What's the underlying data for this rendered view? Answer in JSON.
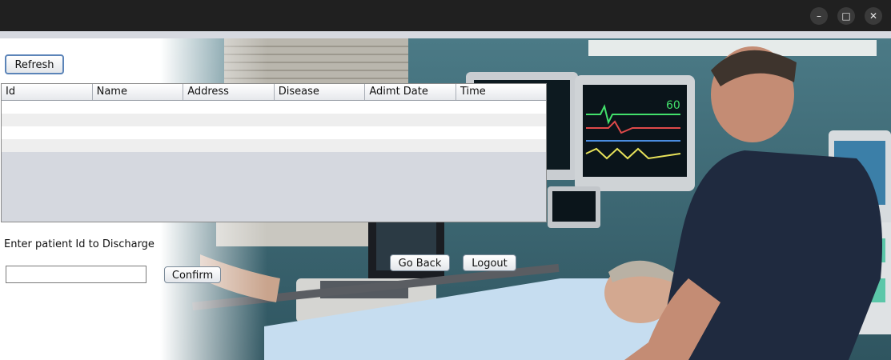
{
  "window": {
    "minimize_icon": "–",
    "maximize_icon": "□",
    "close_icon": "✕"
  },
  "toolbar": {
    "refresh_label": "Refresh"
  },
  "table": {
    "columns": [
      "Id",
      "Name",
      "Address",
      "Disease",
      "Adimt Date",
      "Time"
    ],
    "rows": []
  },
  "discharge": {
    "prompt": "Enter patient Id to Discharge",
    "input_value": "",
    "confirm_label": "Confirm"
  },
  "nav": {
    "go_back_label": "Go Back",
    "logout_label": "Logout"
  },
  "colors": {
    "title_bar": "#202020",
    "table_empty_area": "#d5d8df",
    "button_focus_border": "#5b84b8"
  }
}
